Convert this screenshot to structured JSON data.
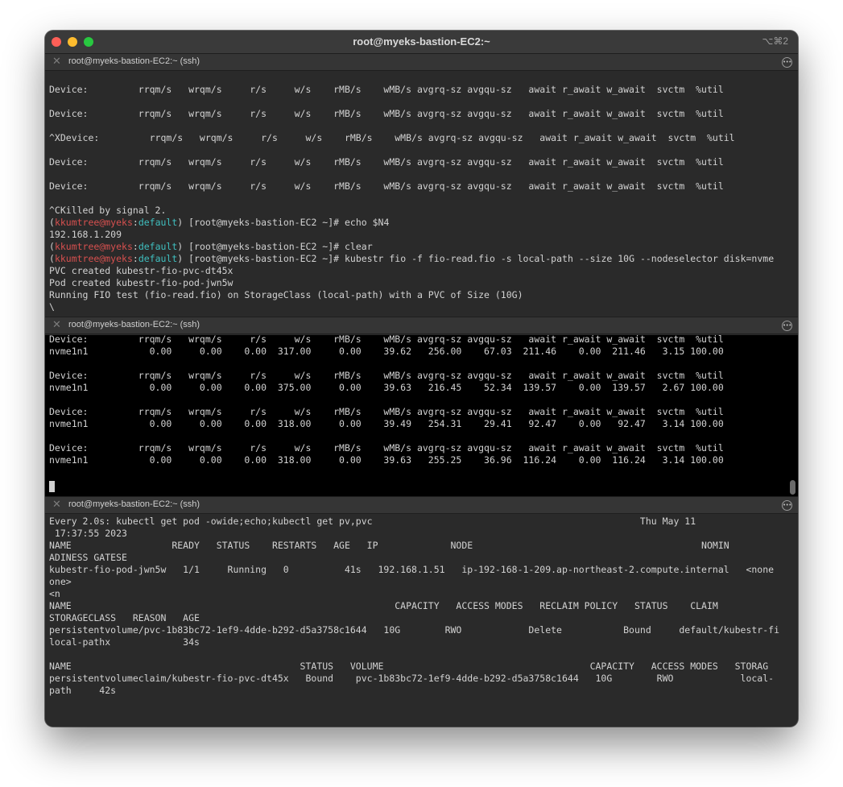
{
  "window": {
    "title": "root@myeks-bastion-EC2:~",
    "shortcut": "⌥⌘2"
  },
  "tabs": [
    {
      "label": "root@myeks-bastion-EC2:~ (ssh)"
    },
    {
      "label": "root@myeks-bastion-EC2:~ (ssh)"
    },
    {
      "label": "root@myeks-bastion-EC2:~ (ssh)"
    }
  ],
  "icons": {
    "close": "close-icon",
    "menu": "more-options-icon",
    "traffic_lights": [
      "close-window",
      "minimize-window",
      "zoom-window"
    ]
  },
  "colors": {
    "prompt_user": "#d7504f",
    "prompt_context": "#3fbfbf",
    "pane_bg": "#2a2a2a",
    "active_pane_bg": "#000000"
  },
  "pane1": {
    "lines": [
      "Device:         rrqm/s   wrqm/s     r/s     w/s    rMB/s    wMB/s avgrq-sz avgqu-sz   await r_await w_await  svctm  %util",
      "",
      "Device:         rrqm/s   wrqm/s     r/s     w/s    rMB/s    wMB/s avgrq-sz avgqu-sz   await r_await w_await  svctm  %util",
      "",
      "^XDevice:         rrqm/s   wrqm/s     r/s     w/s    rMB/s    wMB/s avgrq-sz avgqu-sz   await r_await w_await  svctm  %util",
      "",
      "Device:         rrqm/s   wrqm/s     r/s     w/s    rMB/s    wMB/s avgrq-sz avgqu-sz   await r_await w_await  svctm  %util",
      "",
      "Device:         rrqm/s   wrqm/s     r/s     w/s    rMB/s    wMB/s avgrq-sz avgqu-sz   await r_await w_await  svctm  %util",
      "",
      "^CKilled by signal 2."
    ],
    "prompt": {
      "open_paren": "(",
      "user_host": "kkumtree@myeks",
      "sep": ":",
      "context": "default",
      "rest": ") [root@myeks-bastion-EC2 ~]# "
    },
    "cmd1": "echo $N4",
    "out1": "192.168.1.209",
    "cmd2": "clear",
    "cmd3": "kubestr fio -f fio-read.fio -s local-path --size 10G --nodeselector disk=nvme",
    "out3": [
      "PVC created kubestr-fio-pvc-dt45x",
      "Pod created kubestr-fio-pod-jwn5w",
      "Running FIO test (fio-read.fio) on StorageClass (local-path) with a PVC of Size (10G)",
      "\\"
    ]
  },
  "pane2": {
    "lines": [
      "Device:         rrqm/s   wrqm/s     r/s     w/s    rMB/s    wMB/s avgrq-sz avgqu-sz   await r_await w_await  svctm  %util",
      "nvme1n1           0.00     0.00    0.00  317.00     0.00    39.62   256.00    67.03  211.46    0.00  211.46   3.15 100.00",
      "",
      "Device:         rrqm/s   wrqm/s     r/s     w/s    rMB/s    wMB/s avgrq-sz avgqu-sz   await r_await w_await  svctm  %util",
      "nvme1n1           0.00     0.00    0.00  375.00     0.00    39.63   216.45    52.34  139.57    0.00  139.57   2.67 100.00",
      "",
      "Device:         rrqm/s   wrqm/s     r/s     w/s    rMB/s    wMB/s avgrq-sz avgqu-sz   await r_await w_await  svctm  %util",
      "nvme1n1           0.00     0.00    0.00  318.00     0.00    39.49   254.31    29.41   92.47    0.00   92.47   3.14 100.00",
      "",
      "Device:         rrqm/s   wrqm/s     r/s     w/s    rMB/s    wMB/s avgrq-sz avgqu-sz   await r_await w_await  svctm  %util",
      "nvme1n1           0.00     0.00    0.00  318.00     0.00    39.63   255.25    36.96  116.24    0.00  116.24   3.14 100.00"
    ]
  },
  "pane3": {
    "lines": [
      "Every 2.0s: kubectl get pod -owide;echo;kubectl get pv,pvc                                                Thu May 11",
      " 17:37:55 2023",
      "NAME                  READY   STATUS    RESTARTS   AGE   IP             NODE                                         NOMIN",
      "ADINESS GATESE",
      "kubestr-fio-pod-jwn5w   1/1     Running   0          41s   192.168.1.51   ip-192-168-1-209.ap-northeast-2.compute.internal   <none",
      "one>",
      "<n",
      "NAME                                                          CAPACITY   ACCESS MODES   RECLAIM POLICY   STATUS    CLAIM",
      "STORAGECLASS   REASON   AGE",
      "persistentvolume/pvc-1b83bc72-1ef9-4dde-b292-d5a3758c1644   10G        RWO            Delete           Bound     default/kubestr-fi",
      "local-pathx             34s",
      "",
      "NAME                                         STATUS   VOLUME                                     CAPACITY   ACCESS MODES   STORAG",
      "persistentvolumeclaim/kubestr-fio-pvc-dt45x   Bound    pvc-1b83bc72-1ef9-4dde-b292-d5a3758c1644   10G        RWO            local-",
      "path     42s"
    ]
  }
}
